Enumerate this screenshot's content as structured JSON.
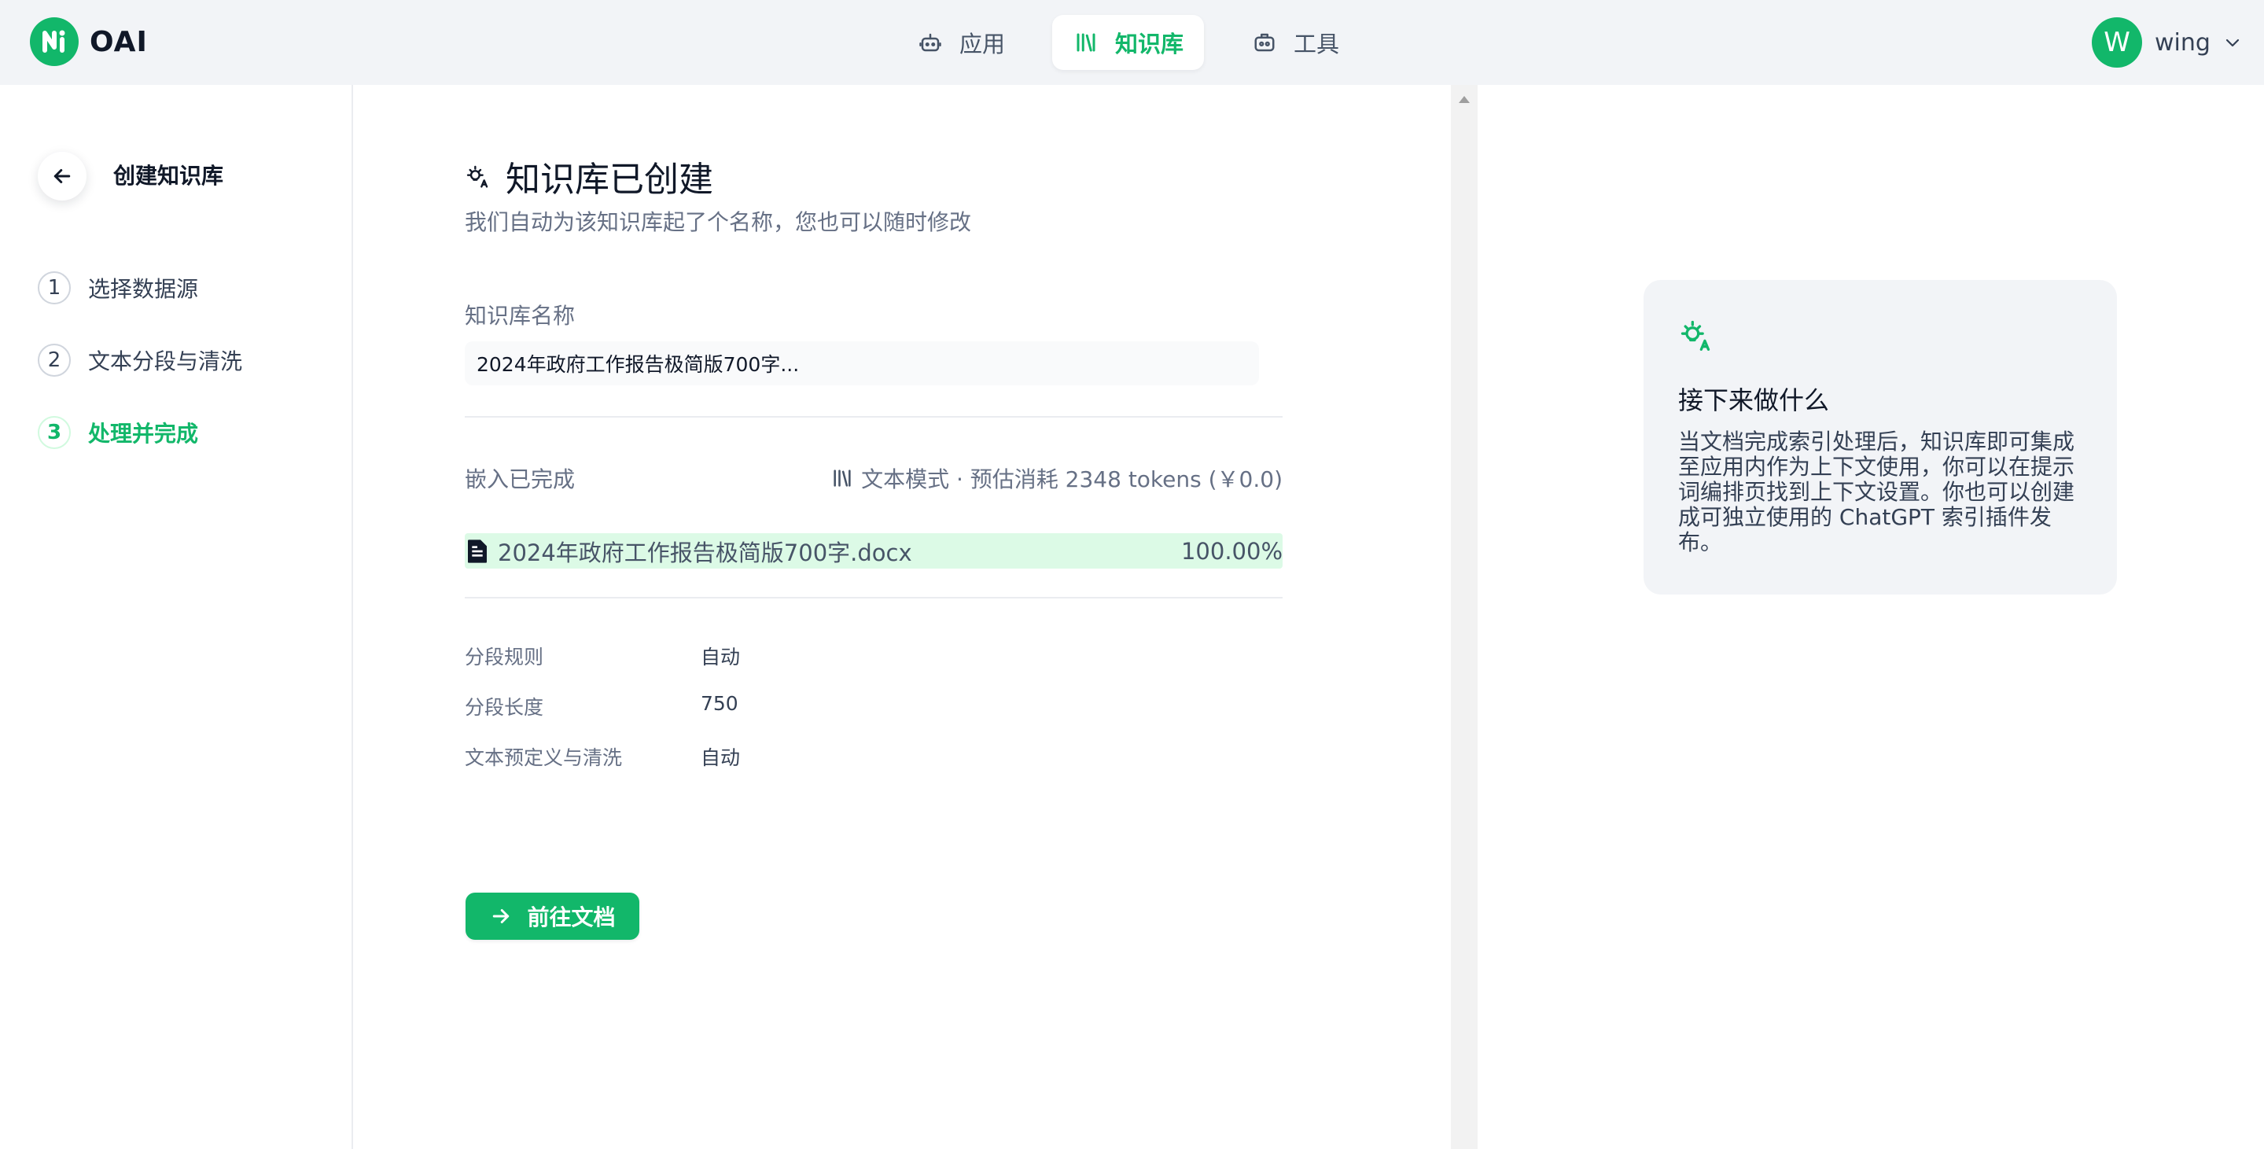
{
  "header": {
    "logo_text": "OAI",
    "nav": [
      {
        "label": "应用",
        "icon": "robot-icon",
        "active": false
      },
      {
        "label": "知识库",
        "icon": "books-icon",
        "active": true
      },
      {
        "label": "工具",
        "icon": "toolbox-icon",
        "active": false
      }
    ],
    "user": {
      "avatar_letter": "W",
      "name": "wing"
    }
  },
  "sidebar": {
    "title": "创建知识库",
    "steps": [
      {
        "number": "1",
        "label": "选择数据源"
      },
      {
        "number": "2",
        "label": "文本分段与清洗"
      },
      {
        "number": "3",
        "label": "处理并完成",
        "active": true
      }
    ]
  },
  "main": {
    "title": "知识库已创建",
    "subtitle": "我们自动为该知识库起了个名称，您也可以随时修改",
    "name_label": "知识库名称",
    "name_value": "2024年政府工作报告极简版700字...",
    "embed_label": "嵌入已完成",
    "embed_info": "文本模式 · 预估消耗 2348 tokens (￥0.0)",
    "file": {
      "name": "2024年政府工作报告极简版700字.docx",
      "progress_text": "100.00%",
      "progress": 100
    },
    "rules": [
      {
        "key": "分段规则",
        "value": "自动"
      },
      {
        "key": "分段长度",
        "value": "750"
      },
      {
        "key": "文本预定义与清洗",
        "value": "自动"
      }
    ],
    "go_button": "前往文档"
  },
  "tip": {
    "title": "接下来做什么",
    "body": "当文档完成索引处理后，知识库即可集成至应用内作为上下文使用，你可以在提示词编排页找到上下文设置。你也可以创建成可独立使用的 ChatGPT 索引插件发布。"
  },
  "colors": {
    "accent": "#12b76a",
    "progress_bg": "#dcfae6",
    "topbar_bg": "#f2f4f7"
  }
}
